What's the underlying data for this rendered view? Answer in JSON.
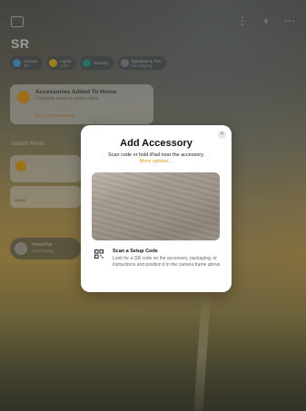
{
  "header": {
    "home_name": "SR",
    "icons": [
      "sidebar-icon",
      "waveform-icon",
      "plus-icon",
      "ellipsis-icon"
    ]
  },
  "chips": [
    {
      "title": "Climate",
      "sub": "20°",
      "color": "#4aa3df"
    },
    {
      "title": "Lights",
      "sub": "1 On",
      "color": "#e0b62a"
    },
    {
      "title": "Security",
      "sub": "",
      "color": "#2f9e8f"
    },
    {
      "title": "Speakers & TVs",
      "sub": "Not Playing",
      "color": "#8e8e93"
    }
  ],
  "banner": {
    "title": "Accessories Added To Home",
    "subtitle": "Complete setup to control them.",
    "link": "Set Up Accessories"
  },
  "sections": {
    "default_room": "Default Room",
    "section_2": ""
  },
  "tiles": [
    {
      "label": ""
    },
    {
      "label": "Home"
    }
  ],
  "homepod": {
    "name": "HomePod",
    "status": "Not Playing"
  },
  "modal": {
    "title": "Add Accessory",
    "subtitle": "Scan code or hold iPad near the accessory.",
    "more_options": "More options...",
    "close_glyph": "✕",
    "scan_title": "Scan a Setup Code",
    "scan_desc": "Look for a QR code on the accessory, packaging, or instructions and position it in the camera frame above."
  },
  "colors": {
    "accent": "#e3951a",
    "modal_bg": "#ffffff"
  }
}
